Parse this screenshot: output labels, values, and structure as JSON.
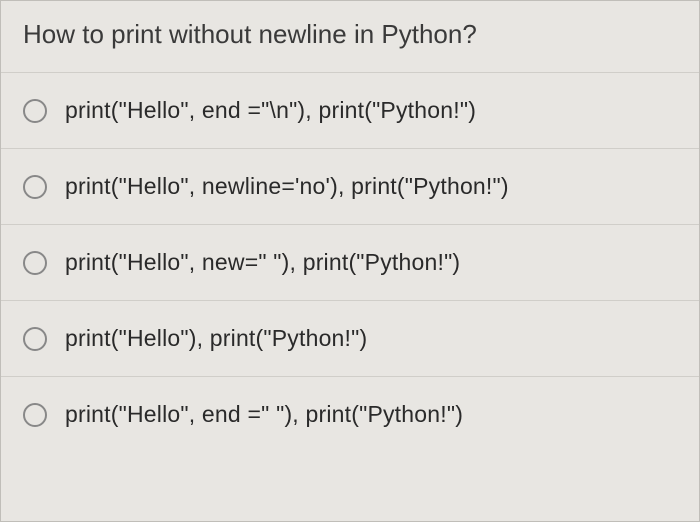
{
  "question": "How to print without newline in Python?",
  "options": [
    {
      "label": "print(\"Hello\", end =\"\\n\"), print(\"Python!\")"
    },
    {
      "label": "print(\"Hello\", newline='no'), print(\"Python!\")"
    },
    {
      "label": "print(\"Hello\", new=\" \"), print(\"Python!\")"
    },
    {
      "label": "print(\"Hello\"), print(\"Python!\")"
    },
    {
      "label": "print(\"Hello\", end =\" \"), print(\"Python!\")"
    }
  ]
}
